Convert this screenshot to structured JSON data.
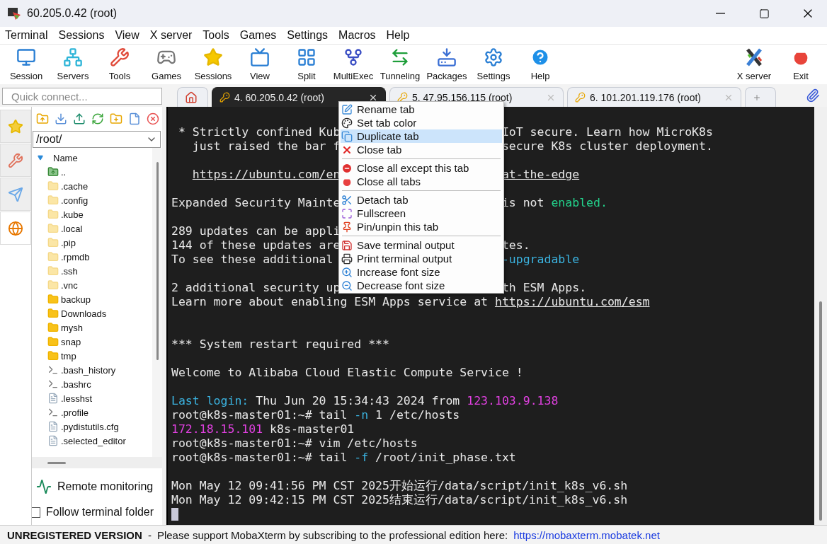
{
  "window": {
    "title": "60.205.0.42 (root)"
  },
  "menu_bar": [
    "Terminal",
    "Sessions",
    "View",
    "X server",
    "Tools",
    "Games",
    "Settings",
    "Macros",
    "Help"
  ],
  "toolbar": {
    "left": [
      "Session",
      "Servers",
      "Tools",
      "Games",
      "Sessions",
      "View",
      "Split",
      "MultiExec",
      "Tunneling",
      "Packages",
      "Settings",
      "Help"
    ],
    "right": [
      "X server",
      "Exit"
    ]
  },
  "quick_connect": {
    "placeholder": "Quick connect..."
  },
  "tabs": [
    {
      "kind": "home",
      "selected": false
    },
    {
      "kind": "session",
      "label": "4. 60.205.0.42 (root)",
      "selected": true
    },
    {
      "kind": "session",
      "label": "5. 47.95.156.115 (root)",
      "selected": false
    },
    {
      "kind": "session",
      "label": "6. 101.201.119.176 (root)",
      "selected": false
    },
    {
      "kind": "new",
      "selected": false
    }
  ],
  "side_tabs": [
    {
      "selected": false
    },
    {
      "selected": false
    },
    {
      "selected": false
    },
    {
      "selected": true
    }
  ],
  "file_browser": {
    "path": "/root/",
    "column": "Name",
    "files": [
      {
        "name": "..",
        "kind": "up"
      },
      {
        "name": ".cache",
        "kind": "hidden-folder"
      },
      {
        "name": ".config",
        "kind": "hidden-folder"
      },
      {
        "name": ".kube",
        "kind": "hidden-folder"
      },
      {
        "name": ".local",
        "kind": "hidden-folder"
      },
      {
        "name": ".pip",
        "kind": "hidden-folder"
      },
      {
        "name": ".rpmdb",
        "kind": "hidden-folder"
      },
      {
        "name": ".ssh",
        "kind": "hidden-folder"
      },
      {
        "name": ".vnc",
        "kind": "hidden-folder"
      },
      {
        "name": "backup",
        "kind": "folder"
      },
      {
        "name": "Downloads",
        "kind": "folder"
      },
      {
        "name": "mysh",
        "kind": "folder"
      },
      {
        "name": "snap",
        "kind": "folder"
      },
      {
        "name": "tmp",
        "kind": "folder"
      },
      {
        "name": ".bash_history",
        "kind": "script"
      },
      {
        "name": ".bashrc",
        "kind": "script"
      },
      {
        "name": ".lesshst",
        "kind": "file"
      },
      {
        "name": ".profile",
        "kind": "script"
      },
      {
        "name": ".pydistutils.cfg",
        "kind": "file"
      },
      {
        "name": ".selected_editor",
        "kind": "file"
      }
    ],
    "remote_monitoring": "Remote monitoring",
    "follow_folder": {
      "label": "Follow terminal folder",
      "checked": false
    }
  },
  "terminal": {
    "lines": [
      {
        "kind": "text",
        "left": [
          {
            "text": " * Strictly confined Kub"
          }
        ],
        "right": [
          {
            "text": "IoT secure. Learn how MicroK8s"
          }
        ]
      },
      {
        "kind": "text",
        "left": [
          {
            "text": "   just raised the bar f"
          }
        ],
        "right": [
          {
            "text": "secure K8s cluster deployment."
          }
        ]
      },
      {
        "kind": "blank"
      },
      {
        "kind": "text",
        "indented": true,
        "left": [
          {
            "text": "https://ubuntu.com/en",
            "underline": true
          }
        ],
        "right": [
          {
            "text": "at-the-edge",
            "underline": true
          }
        ]
      },
      {
        "kind": "blank"
      },
      {
        "kind": "text",
        "left": [
          {
            "text": "Expanded Security Mainte"
          }
        ],
        "right": [
          {
            "text": "is not "
          },
          {
            "text": "enabled.",
            "color": "#23d18b"
          }
        ]
      },
      {
        "kind": "blank"
      },
      {
        "kind": "text",
        "left": [
          {
            "text": "289 updates can be appli"
          }
        ]
      },
      {
        "kind": "text",
        "left": [
          {
            "text": "144 of these updates are"
          }
        ],
        "right": [
          {
            "text": "tes."
          }
        ]
      },
      {
        "kind": "text",
        "left": [
          {
            "text": "To see these additional"
          }
        ],
        "right": [
          {
            "text": "-upgradable",
            "color": "#3bb3e0"
          }
        ]
      },
      {
        "kind": "blank"
      },
      {
        "kind": "text",
        "left": [
          {
            "text": "2 additional security up"
          }
        ],
        "right": [
          {
            "text": "th ESM Apps."
          }
        ]
      },
      {
        "kind": "text",
        "left": [
          {
            "text": "Learn more about enabling ESM Apps service at "
          },
          {
            "text": "https://ubuntu.com/esm",
            "underline": true
          }
        ]
      },
      {
        "kind": "blank"
      },
      {
        "kind": "blank"
      },
      {
        "kind": "text",
        "left": [
          {
            "text": "*** System restart required ***"
          }
        ]
      },
      {
        "kind": "blank"
      },
      {
        "kind": "text",
        "left": [
          {
            "text": "Welcome to Alibaba Cloud Elastic Compute Service !"
          }
        ]
      },
      {
        "kind": "blank"
      },
      {
        "kind": "text",
        "left": [
          {
            "text": "Last login:",
            "color": "#3bb3e0"
          },
          {
            "text": " Thu Jun 20 15:34:43 2024 from "
          },
          {
            "text": "123.103.9.138",
            "color": "#e040e0"
          }
        ]
      },
      {
        "kind": "text",
        "left": [
          {
            "text": "root@k8s-master01:~# tail "
          },
          {
            "text": "-n",
            "color": "#3bb3e0"
          },
          {
            "text": " 1 /etc/hosts"
          }
        ]
      },
      {
        "kind": "text",
        "left": [
          {
            "text": "172.18.15.101",
            "color": "#e040e0"
          },
          {
            "text": " k8s-master01"
          }
        ]
      },
      {
        "kind": "text",
        "left": [
          {
            "text": "root@k8s-master01:~# vim /etc/hosts"
          }
        ]
      },
      {
        "kind": "text",
        "left": [
          {
            "text": "root@k8s-master01:~# tail "
          },
          {
            "text": "-f",
            "color": "#3bb3e0"
          },
          {
            "text": " /root/init_phase.txt"
          }
        ]
      },
      {
        "kind": "blank"
      },
      {
        "kind": "text",
        "left": [
          {
            "text": "Mon May 12 09:41:56 PM CST 2025开始运行/data/script/init_k8s_v6.sh"
          }
        ]
      },
      {
        "kind": "text",
        "left": [
          {
            "text": "Mon May 12 09:42:15 PM CST 2025结束运行/data/script/init_k8s_v6.sh"
          }
        ]
      },
      {
        "kind": "cursor"
      }
    ]
  },
  "context_menu": {
    "groups": [
      [
        {
          "label": "Rename tab",
          "selected": false
        },
        {
          "label": "Set tab color",
          "selected": false
        },
        {
          "label": "Duplicate tab",
          "selected": true
        },
        {
          "label": "Close tab",
          "selected": false
        }
      ],
      [
        {
          "label": "Close all except this tab",
          "selected": false
        },
        {
          "label": "Close all tabs",
          "selected": false
        }
      ],
      [
        {
          "label": "Detach tab",
          "selected": false
        },
        {
          "label": "Fullscreen",
          "selected": false
        },
        {
          "label": "Pin/unpin this tab",
          "selected": false
        }
      ],
      [
        {
          "label": "Save terminal output",
          "selected": false
        },
        {
          "label": "Print terminal output",
          "selected": false
        },
        {
          "label": "Increase font size",
          "selected": false
        },
        {
          "label": "Decrease font size",
          "selected": false
        }
      ]
    ]
  },
  "status_bar": {
    "edition": "UNREGISTERED VERSION",
    "separator": "-",
    "message": "Please support MobaXterm by subscribing to the professional edition here:",
    "link": "https://mobaxterm.mobatek.net"
  }
}
